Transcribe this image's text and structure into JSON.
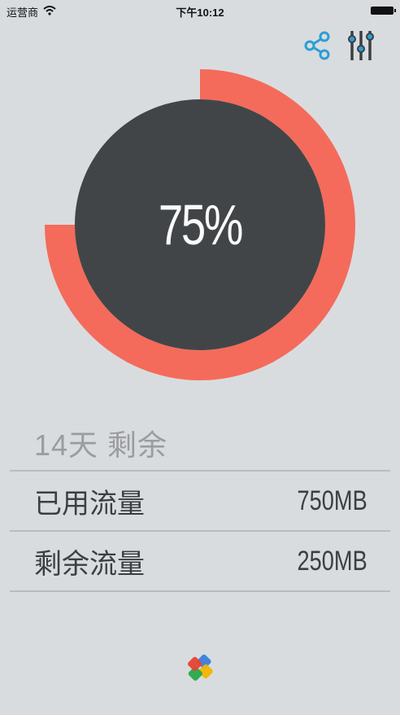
{
  "status_bar": {
    "carrier": "运营商",
    "time": "下午10:12"
  },
  "toolbar": {
    "icons": [
      "share-icon",
      "settings-sliders-icon"
    ],
    "accent_color": "#2a9fd6"
  },
  "usage": {
    "percent_label": "75%",
    "percent_value": 75,
    "ring_color": "#f46b5b",
    "center_color": "#424548"
  },
  "summary": {
    "days_remaining": "14天 剩余"
  },
  "stats": [
    {
      "label": "已用流量",
      "value": "750MB"
    },
    {
      "label": "剩余流量",
      "value": "250MB"
    }
  ]
}
